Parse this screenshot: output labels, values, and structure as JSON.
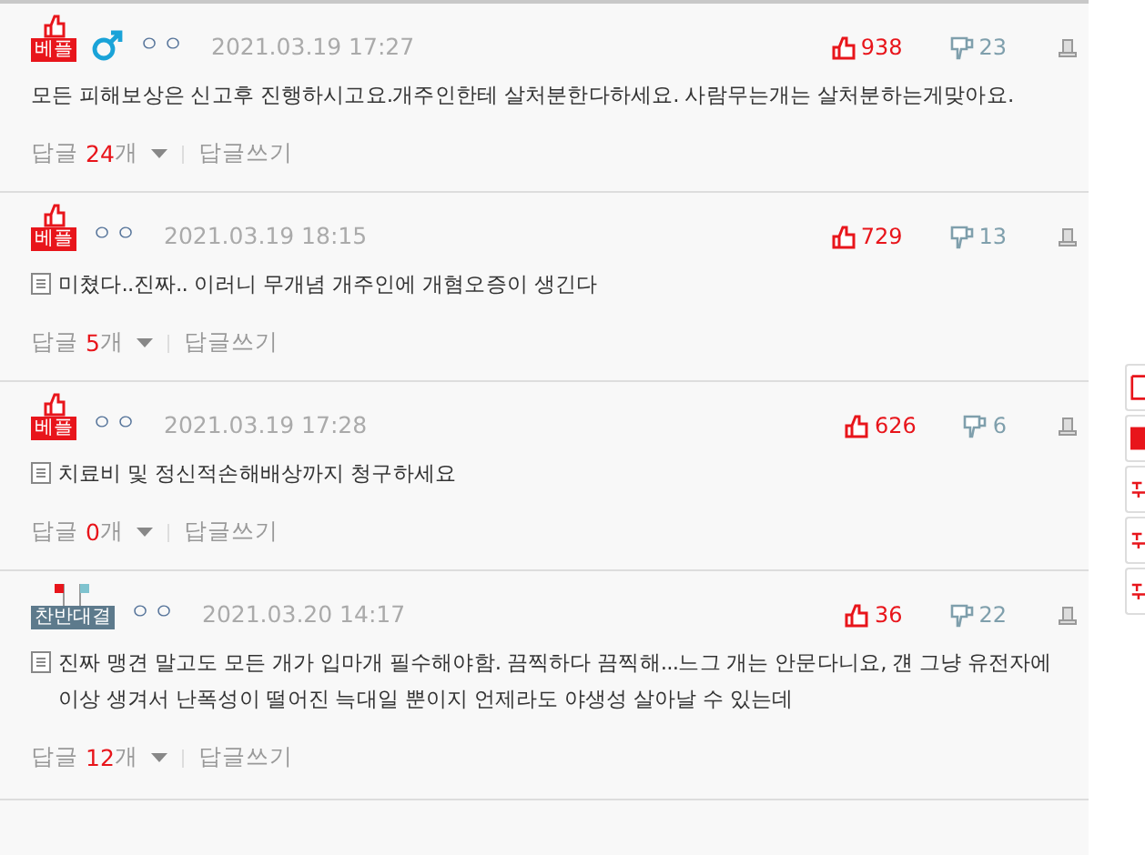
{
  "comments": [
    {
      "badge": {
        "kind": "best",
        "label": "베플"
      },
      "male_symbol": true,
      "nickname": "ㅇㅇ",
      "date": "2021.03.19 17:27",
      "has_doc_icon": false,
      "text": "모든 피해보상은 신고후 진행하시고요.개주인한테 살처분한다하세요. 사람무는개는 살처분하는게맞아요.",
      "likes": "938",
      "dislikes": "23",
      "reply_label": "답글",
      "reply_count": "24",
      "reply_unit": "개",
      "write_reply": "답글쓰기"
    },
    {
      "badge": {
        "kind": "best",
        "label": "베플"
      },
      "male_symbol": false,
      "nickname": "ㅇㅇ",
      "date": "2021.03.19 18:15",
      "has_doc_icon": true,
      "text": "미쳤다..진짜.. 이러니 무개념 개주인에 개혐오증이 생긴다",
      "likes": "729",
      "dislikes": "13",
      "reply_label": "답글",
      "reply_count": "5",
      "reply_unit": "개",
      "write_reply": "답글쓰기"
    },
    {
      "badge": {
        "kind": "best",
        "label": "베플"
      },
      "male_symbol": false,
      "nickname": "ㅇㅇ",
      "date": "2021.03.19 17:28",
      "has_doc_icon": true,
      "text": "치료비 및 정신적손해배상까지 청구하세요",
      "likes": "626",
      "dislikes": "6",
      "reply_label": "답글",
      "reply_count": "0",
      "reply_unit": "개",
      "write_reply": "답글쓰기"
    },
    {
      "badge": {
        "kind": "versus",
        "label": "찬반대결"
      },
      "male_symbol": false,
      "nickname": "ㅇㅇ",
      "date": "2021.03.20 14:17",
      "has_doc_icon": true,
      "text": "진짜 맹견 말고도 모든 개가 입마개 필수해야함. 끔찍하다 끔찍해...느그 개는 안문다니요, 걘 그냥 유전자에 이상 생겨서 난폭성이 떨어진 늑대일 뿐이지 언제라도 야생성 살아날 수 있는데",
      "likes": "36",
      "dislikes": "22",
      "reply_label": "답글",
      "reply_count": "12",
      "reply_unit": "개",
      "write_reply": "답글쓰기"
    }
  ],
  "side_buttons": [
    {
      "kind": "outline"
    },
    {
      "kind": "solid"
    },
    {
      "kind": "glyph"
    },
    {
      "kind": "glyph"
    },
    {
      "kind": "glyph"
    }
  ]
}
